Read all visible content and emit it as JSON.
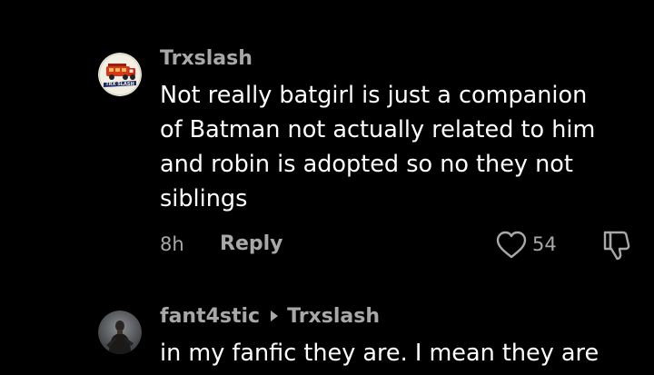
{
  "comments": [
    {
      "username": "Trxslash",
      "avatar_icon": "fire-truck-logo-icon",
      "avatar_logo_text": "TRX SLASH",
      "text_lines": [
        "Not really batgirl is just a companion",
        "of Batman not actually related to him",
        "and robin is adopted so no they not",
        "siblings"
      ],
      "time": "8h",
      "reply_label": "Reply",
      "like_icon": "heart-icon",
      "like_count": "54",
      "dislike_icon": "thumbs-down-icon"
    },
    {
      "username": "fant4stic",
      "replying_to": "Trxslash",
      "avatar_icon": "person-photo-avatar",
      "text_lines": [
        "in my fanfic they are. I mean they are"
      ]
    }
  ],
  "colors": {
    "background": "#000000",
    "primary_text": "#ffffff",
    "secondary_text": "#a8a8a8"
  }
}
